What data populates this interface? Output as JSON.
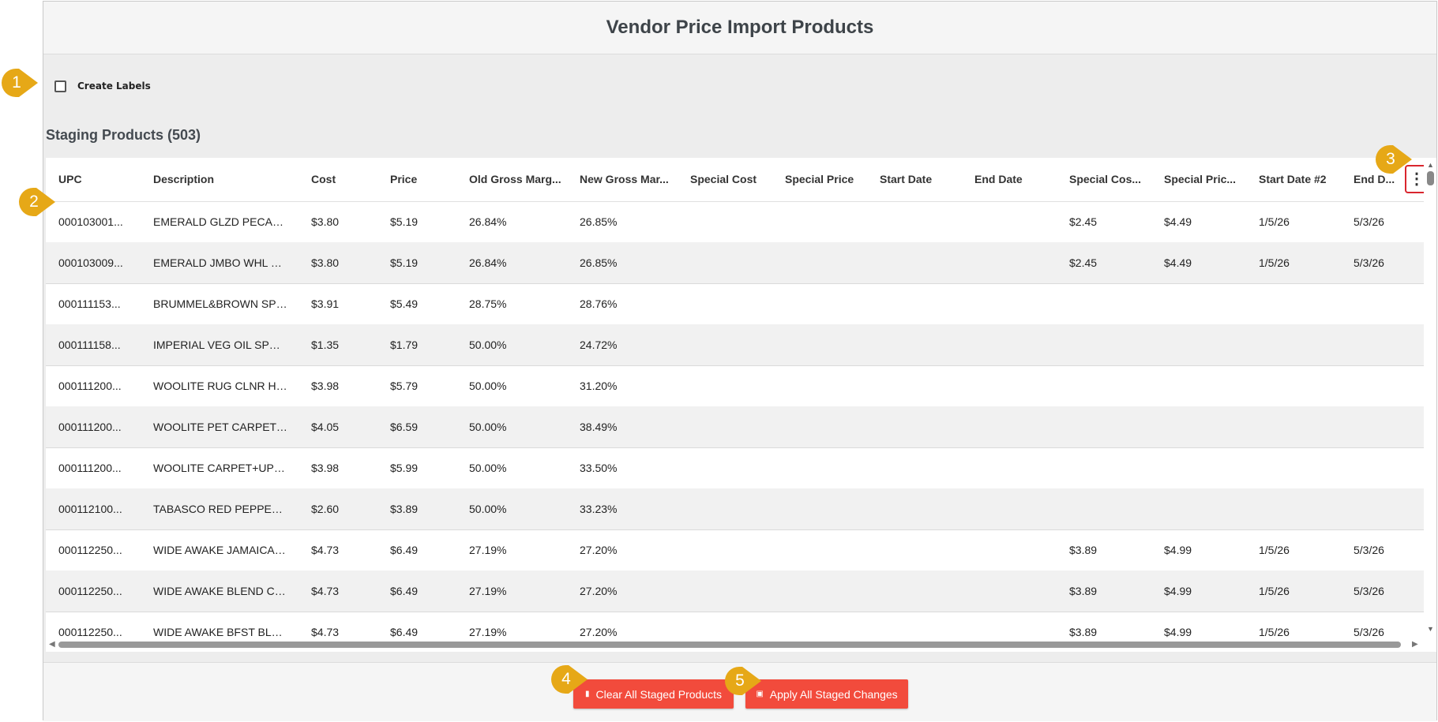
{
  "header": {
    "title": "Vendor Price Import Products"
  },
  "create_labels": {
    "label": "Create Labels",
    "checked": false
  },
  "staging": {
    "title": "Staging Products (503)"
  },
  "table": {
    "columns": [
      "UPC",
      "Description",
      "Cost",
      "Price",
      "Old Gross Marg...",
      "New Gross Mar...",
      "Special Cost",
      "Special Price",
      "Start Date",
      "End Date",
      "Special Cos...",
      "Special Pric...",
      "Start Date #2",
      "End D..."
    ],
    "rows": [
      [
        "000103001...",
        "EMERALD GLZD PECAN ...",
        "$3.80",
        "$5.19",
        "26.84%",
        "26.85%",
        "",
        "",
        "",
        "",
        "$2.45",
        "$4.49",
        "1/5/26",
        "5/3/26"
      ],
      [
        "000103009...",
        "EMERALD JMBO WHL C...",
        "$3.80",
        "$5.19",
        "26.84%",
        "26.85%",
        "",
        "",
        "",
        "",
        "$2.45",
        "$4.49",
        "1/5/26",
        "5/3/26"
      ],
      [
        "000111153...",
        "BRUMMEL&BROWN SPR...",
        "$3.91",
        "$5.49",
        "28.75%",
        "28.76%",
        "",
        "",
        "",
        "",
        "",
        "",
        "",
        ""
      ],
      [
        "000111158...",
        "IMPERIAL VEG OIL SPRE...",
        "$1.35",
        "$1.79",
        "50.00%",
        "24.72%",
        "",
        "",
        "",
        "",
        "",
        "",
        "",
        ""
      ],
      [
        "000111200...",
        "WOOLITE RUG CLNR HV...",
        "$3.98",
        "$5.79",
        "50.00%",
        "31.20%",
        "",
        "",
        "",
        "",
        "",
        "",
        "",
        ""
      ],
      [
        "000111200...",
        "WOOLITE PET CARPET C...",
        "$4.05",
        "$6.59",
        "50.00%",
        "38.49%",
        "",
        "",
        "",
        "",
        "",
        "",
        "",
        ""
      ],
      [
        "000111200...",
        "WOOLITE CARPET+UPH...",
        "$3.98",
        "$5.99",
        "50.00%",
        "33.50%",
        "",
        "",
        "",
        "",
        "",
        "",
        "",
        ""
      ],
      [
        "000112100...",
        "TABASCO RED PEPPER S...",
        "$2.60",
        "$3.89",
        "50.00%",
        "33.23%",
        "",
        "",
        "",
        "",
        "",
        "",
        "",
        ""
      ],
      [
        "000112250...",
        "WIDE AWAKE JAMAICAN...",
        "$4.73",
        "$6.49",
        "27.19%",
        "27.20%",
        "",
        "",
        "",
        "",
        "$3.89",
        "$4.99",
        "1/5/26",
        "5/3/26"
      ],
      [
        "000112250...",
        "WIDE AWAKE BLEND CO...",
        "$4.73",
        "$6.49",
        "27.19%",
        "27.20%",
        "",
        "",
        "",
        "",
        "$3.89",
        "$4.99",
        "1/5/26",
        "5/3/26"
      ],
      [
        "000112250...",
        "WIDE AWAKE BFST BLN...",
        "$4.73",
        "$6.49",
        "27.19%",
        "27.20%",
        "",
        "",
        "",
        "",
        "$3.89",
        "$4.99",
        "1/5/26",
        "5/3/26"
      ]
    ],
    "menu_icon": "more-vertical-icon"
  },
  "footer": {
    "clear_label": "Clear All Staged Products",
    "apply_label": "Apply All Staged Changes",
    "clear_icon": "trash-icon",
    "apply_icon": "save-icon"
  },
  "callouts": [
    "1",
    "2",
    "3",
    "4",
    "5"
  ],
  "colors": {
    "accent_red": "#f24b3c",
    "callout_gold": "#e6a817",
    "highlight_border": "#d9262e"
  }
}
